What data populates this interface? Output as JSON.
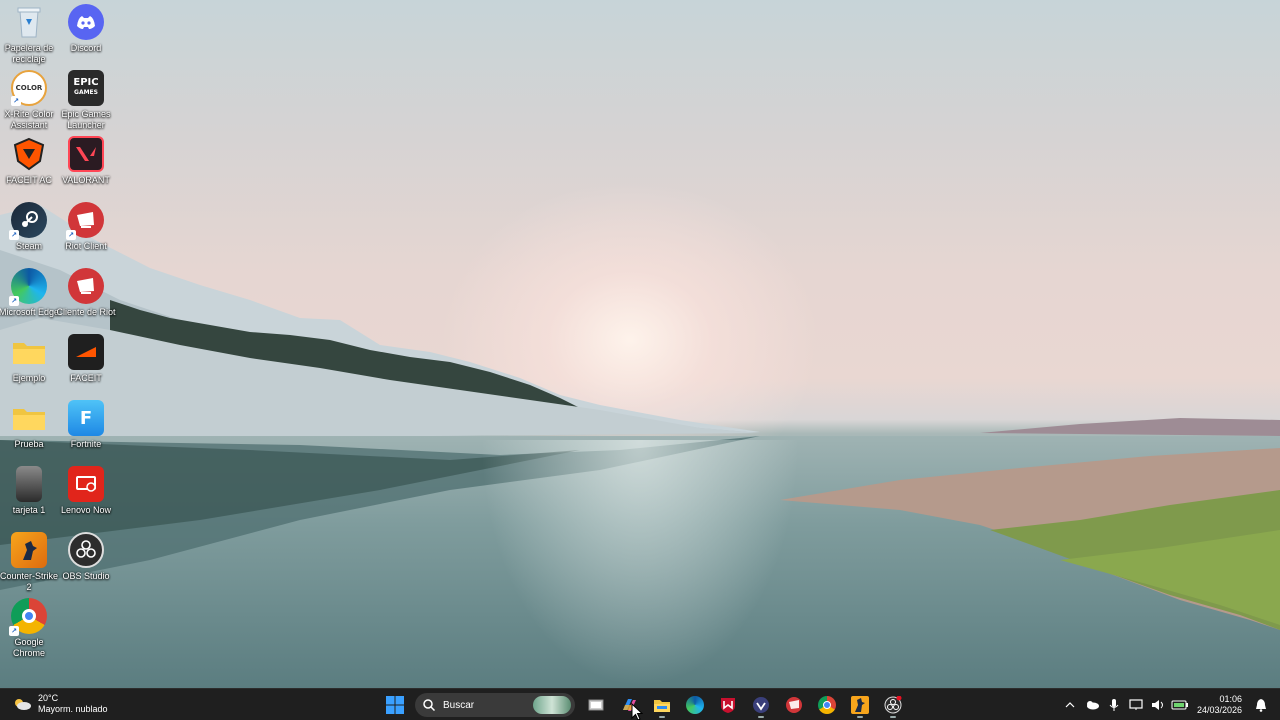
{
  "desktop": {
    "icons": [
      {
        "label": "Papelera de reciclaje",
        "icon": "recycle-bin-icon"
      },
      {
        "label": "Discord",
        "icon": "discord-icon"
      },
      {
        "label": "X-Rite Color Assistant",
        "icon": "xrite-icon"
      },
      {
        "label": "Epic Games Launcher",
        "icon": "epic-games-icon"
      },
      {
        "label": "FACEIT AC",
        "icon": "faceit-ac-icon"
      },
      {
        "label": "VALORANT",
        "icon": "valorant-icon"
      },
      {
        "label": "Steam",
        "icon": "steam-icon"
      },
      {
        "label": "Riot Client",
        "icon": "riot-client-icon"
      },
      {
        "label": "Microsoft Edge",
        "icon": "edge-icon"
      },
      {
        "label": "Cliente de Riot",
        "icon": "riot-client-icon"
      },
      {
        "label": "Ejemplo",
        "icon": "folder-icon"
      },
      {
        "label": "FACEIT",
        "icon": "faceit-icon"
      },
      {
        "label": "Prueba",
        "icon": "folder-icon"
      },
      {
        "label": "Fortnite",
        "icon": "fortnite-icon"
      },
      {
        "label": "tarjeta 1",
        "icon": "image-file-icon"
      },
      {
        "label": "Lenovo Now",
        "icon": "lenovo-now-icon"
      },
      {
        "label": "Counter-Strike 2",
        "icon": "cs2-icon"
      },
      {
        "label": "OBS Studio",
        "icon": "obs-icon"
      },
      {
        "label": "Google Chrome",
        "icon": "chrome-icon"
      }
    ]
  },
  "taskbar": {
    "weather": {
      "temp": "20°C",
      "desc": "Mayorm. nublado"
    },
    "search_placeholder": "Buscar",
    "apps": [
      "start-icon",
      "search",
      "task-view-icon",
      "copilot-icon",
      "file-explorer-icon",
      "edge-icon",
      "mcafee-icon",
      "vpn-icon",
      "riot-icon",
      "chrome-icon",
      "cs2-icon",
      "obs-icon"
    ],
    "clock": {
      "time": "01:06",
      "date": "24/03/2026"
    }
  }
}
